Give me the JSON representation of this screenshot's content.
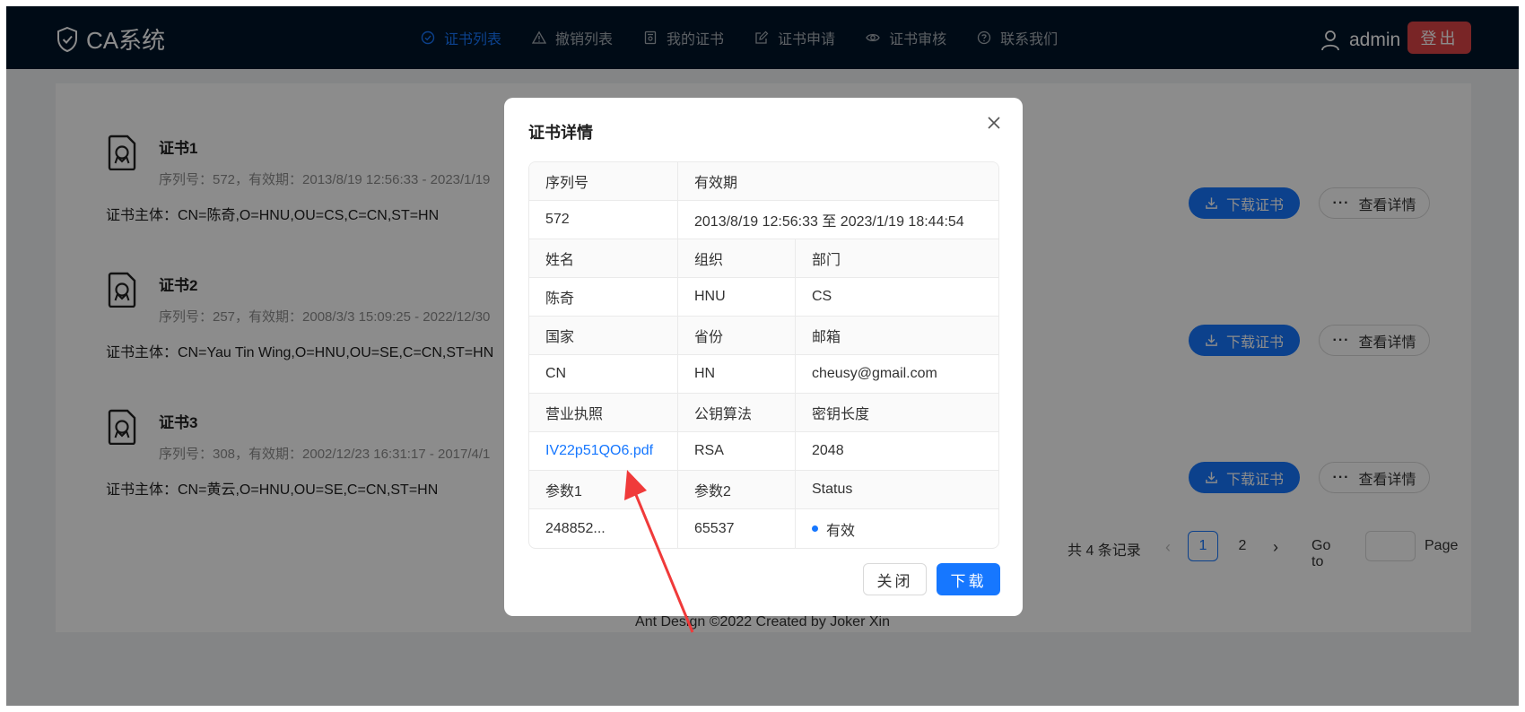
{
  "header": {
    "app_title": "CA系统",
    "nav": [
      {
        "label": "证书列表",
        "icon": "check-circle-icon",
        "active": true
      },
      {
        "label": "撤销列表",
        "icon": "warning-icon",
        "active": false
      },
      {
        "label": "我的证书",
        "icon": "certificate-icon",
        "active": false
      },
      {
        "label": "证书申请",
        "icon": "edit-icon",
        "active": false
      },
      {
        "label": "证书审核",
        "icon": "eye-icon",
        "active": false
      },
      {
        "label": "联系我们",
        "icon": "question-circle-icon",
        "active": false
      }
    ],
    "username": "admin",
    "logout_label": "登出"
  },
  "certificates": [
    {
      "title": "证书1",
      "desc": "序列号：572，有效期：2013/8/19 12:56:33 - 2023/1/19",
      "subject": "证书主体：CN=陈奇,O=HNU,OU=CS,C=CN,ST=HN",
      "download_label": "下载证书",
      "detail_label": "查看详情"
    },
    {
      "title": "证书2",
      "desc": "序列号：257，有效期：2008/3/3 15:09:25 - 2022/12/30",
      "subject": "证书主体：CN=Yau Tin Wing,O=HNU,OU=SE,C=CN,ST=HN",
      "download_label": "下载证书",
      "detail_label": "查看详情"
    },
    {
      "title": "证书3",
      "desc": "序列号：308，有效期：2002/12/23 16:31:17 - 2017/4/1",
      "subject": "证书主体：CN=黄云,O=HNU,OU=SE,C=CN,ST=HN",
      "download_label": "下载证书",
      "detail_label": "查看详情"
    }
  ],
  "pagination": {
    "total_text": "共 4 条记录",
    "pages": [
      "1",
      "2"
    ],
    "current": "1",
    "goto_label": "Go to",
    "page_label": "Page"
  },
  "footer": "Ant Design ©2022 Created by Joker Xin",
  "modal": {
    "title": "证书详情",
    "row1_labels": [
      "序列号",
      "有效期"
    ],
    "row1_values": [
      "572",
      "2013/8/19 12:56:33 至 2023/1/19 18:44:54"
    ],
    "row2_labels": [
      "姓名",
      "组织",
      "部门"
    ],
    "row2_values": [
      "陈奇",
      "HNU",
      "CS"
    ],
    "row3_labels": [
      "国家",
      "省份",
      "邮箱"
    ],
    "row3_values": [
      "CN",
      "HN",
      "cheusy@gmail.com"
    ],
    "row4_labels": [
      "营业执照",
      "公钥算法",
      "密钥长度"
    ],
    "row4_values": [
      "IV22p51QO6.pdf",
      "RSA",
      "2048"
    ],
    "row5_labels": [
      "参数1",
      "参数2",
      "Status"
    ],
    "row5_values": [
      "248852...",
      "65537",
      "有效"
    ],
    "close_label": "关闭",
    "download_label": "下载"
  },
  "colors": {
    "header_bg": "#001529",
    "primary": "#1677ff",
    "danger": "#dc4446",
    "annotation_arrow": "#f03a3a"
  }
}
